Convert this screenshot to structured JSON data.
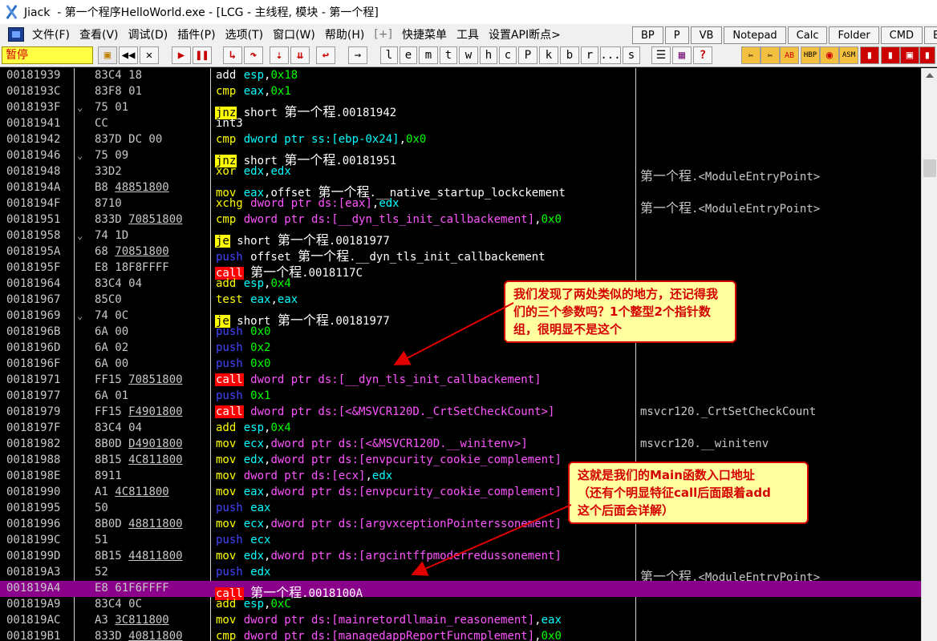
{
  "titlebar": {
    "app_title": "Jiack  - 第一个程序HelloWorld.exe - [LCG - 主线程, 模块 - 第一个程]"
  },
  "menubar": {
    "items": [
      "文件(F)",
      "查看(V)",
      "调试(D)",
      "插件(P)",
      "选项(T)",
      "窗口(W)",
      "帮助(H)",
      "[+]",
      "快捷菜单",
      "工具",
      "设置API断点>"
    ],
    "quick_buttons": [
      "BP",
      "P",
      "VB",
      "Notepad",
      "Calc",
      "Folder",
      "CMD",
      "E"
    ]
  },
  "toolbar": {
    "status": "暂停",
    "letter_buttons": [
      "l",
      "e",
      "m",
      "t",
      "w",
      "h",
      "c",
      "P",
      "k",
      "b",
      "r",
      "...",
      "s"
    ]
  },
  "disasm": {
    "rows": [
      {
        "addr": "00181939",
        "bytes": "83C4 18",
        "jmark": "",
        "mnem": "add",
        "mclass": "plain",
        "ops": [
          [
            "op-reg",
            "esp"
          ],
          [
            "op-text",
            ","
          ],
          [
            "op-imm",
            "0x18"
          ]
        ],
        "comment": ""
      },
      {
        "addr": "0018193C",
        "bytes": "83F8 01",
        "jmark": "",
        "mnem": "cmp",
        "mclass": "cmp",
        "ops": [
          [
            "op-reg",
            "eax"
          ],
          [
            "op-text",
            ","
          ],
          [
            "op-imm",
            "0x1"
          ]
        ],
        "comment": ""
      },
      {
        "addr": "0018193F",
        "bytes": "75 01",
        "jmark": "⌄",
        "mnem": "jnz",
        "mclass": "jmp",
        "ops": [
          [
            "op-text",
            " short "
          ],
          [
            "cjk",
            "第一个程"
          ],
          [
            "op-text",
            ".00181942"
          ]
        ],
        "comment": ""
      },
      {
        "addr": "00181941",
        "bytes": "CC",
        "jmark": "",
        "mnem": "int3",
        "mclass": "plain",
        "ops": [],
        "comment": ""
      },
      {
        "addr": "00181942",
        "bytes": "837D DC 00",
        "jmark": "",
        "mnem": "cmp",
        "mclass": "cmp",
        "ops": [
          [
            "op-reg",
            "dword ptr ss:[ebp-0x24]"
          ],
          [
            "op-text",
            ","
          ],
          [
            "op-imm",
            "0x0"
          ]
        ],
        "comment": ""
      },
      {
        "addr": "00181946",
        "bytes": "75 09",
        "jmark": "⌄",
        "mnem": "jnz",
        "mclass": "jmp",
        "ops": [
          [
            "op-text",
            " short "
          ],
          [
            "cjk",
            "第一个程"
          ],
          [
            "op-text",
            ".00181951"
          ]
        ],
        "comment": ""
      },
      {
        "addr": "00181948",
        "bytes": "33D2",
        "jmark": "",
        "mnem": "xor",
        "mclass": "mov",
        "ops": [
          [
            "op-reg",
            "edx"
          ],
          [
            "op-text",
            ","
          ],
          [
            "op-reg",
            "edx"
          ]
        ],
        "comment": "第一个程.<ModuleEntryPoint>"
      },
      {
        "addr": "0018194A",
        "bytes": "B8 48851800",
        "ul": "48851800",
        "jmark": "",
        "mnem": "mov",
        "mclass": "mov",
        "ops": [
          [
            "op-reg",
            "eax"
          ],
          [
            "op-text",
            ",offset "
          ],
          [
            "cjk",
            "第一个程"
          ],
          [
            "op-text",
            ".__native_startup_lockckement"
          ]
        ],
        "comment": ""
      },
      {
        "addr": "0018194F",
        "bytes": "8710",
        "jmark": "",
        "mnem": "xchg",
        "mclass": "mov",
        "ops": [
          [
            "op-mem",
            "dword ptr ds:[eax]"
          ],
          [
            "op-text",
            ","
          ],
          [
            "op-reg",
            "edx"
          ]
        ],
        "comment": "第一个程.<ModuleEntryPoint>"
      },
      {
        "addr": "00181951",
        "bytes": "833D 70851800",
        "ul": "70851800",
        "jmark": "",
        "mnem": "cmp",
        "mclass": "cmp",
        "ops": [
          [
            "op-mem",
            "dword ptr ds:[__dyn_tls_init_callbackement]"
          ],
          [
            "op-text",
            ","
          ],
          [
            "op-imm",
            "0x0"
          ]
        ],
        "comment": ""
      },
      {
        "addr": "00181958",
        "bytes": "74 1D",
        "jmark": "⌄",
        "mnem": "je",
        "mclass": "jmp",
        "ops": [
          [
            "op-text",
            " short "
          ],
          [
            "cjk",
            "第一个程"
          ],
          [
            "op-text",
            ".00181977"
          ]
        ],
        "comment": ""
      },
      {
        "addr": "0018195A",
        "bytes": "68 70851800",
        "ul": "70851800",
        "jmark": "",
        "mnem": "push",
        "mclass": "push",
        "ops": [
          [
            "op-text",
            " offset "
          ],
          [
            "cjk",
            "第一个程"
          ],
          [
            "op-text",
            ".__dyn_tls_init_callbackement"
          ]
        ],
        "comment": ""
      },
      {
        "addr": "0018195F",
        "bytes": "E8 18F8FFFF",
        "jmark": "",
        "mnem": "call",
        "mclass": "call",
        "ops": [
          [
            "op-text",
            " "
          ],
          [
            "cjk",
            "第一个程"
          ],
          [
            "op-text",
            ".0018117C"
          ]
        ],
        "comment": ""
      },
      {
        "addr": "00181964",
        "bytes": "83C4 04",
        "jmark": "",
        "mnem": "add",
        "mclass": "mov",
        "ops": [
          [
            "op-reg",
            "esp"
          ],
          [
            "op-text",
            ","
          ],
          [
            "op-imm",
            "0x4"
          ]
        ],
        "comment": ""
      },
      {
        "addr": "00181967",
        "bytes": "85C0",
        "jmark": "",
        "mnem": "test",
        "mclass": "mov",
        "ops": [
          [
            "op-reg",
            "eax"
          ],
          [
            "op-text",
            ","
          ],
          [
            "op-reg",
            "eax"
          ]
        ],
        "comment": ""
      },
      {
        "addr": "00181969",
        "bytes": "74 0C",
        "jmark": "⌄",
        "mnem": "je",
        "mclass": "jmp",
        "ops": [
          [
            "op-text",
            " short "
          ],
          [
            "cjk",
            "第一个程"
          ],
          [
            "op-text",
            ".00181977"
          ]
        ],
        "comment": ""
      },
      {
        "addr": "0018196B",
        "bytes": "6A 00",
        "jmark": "",
        "mnem": "push",
        "mclass": "push",
        "ops": [
          [
            "op-imm",
            " 0x0"
          ]
        ],
        "comment": ""
      },
      {
        "addr": "0018196D",
        "bytes": "6A 02",
        "jmark": "",
        "mnem": "push",
        "mclass": "push",
        "ops": [
          [
            "op-imm",
            " 0x2"
          ]
        ],
        "comment": ""
      },
      {
        "addr": "0018196F",
        "bytes": "6A 00",
        "jmark": "",
        "mnem": "push",
        "mclass": "push",
        "ops": [
          [
            "op-imm",
            " 0x0"
          ]
        ],
        "comment": ""
      },
      {
        "addr": "00181971",
        "bytes": "FF15 70851800",
        "ul": "70851800",
        "jmark": "",
        "mnem": "call",
        "mclass": "call",
        "ops": [
          [
            "op-mem",
            " dword ptr ds:[__dyn_tls_init_callbackement]"
          ]
        ],
        "comment": ""
      },
      {
        "addr": "00181977",
        "bytes": "6A 01",
        "jmark": "",
        "mnem": "push",
        "mclass": "push",
        "ops": [
          [
            "op-imm",
            " 0x1"
          ]
        ],
        "comment": ""
      },
      {
        "addr": "00181979",
        "bytes": "FF15 F4901800",
        "ul": "F4901800",
        "jmark": "",
        "mnem": "call",
        "mclass": "call",
        "ops": [
          [
            "op-mem",
            " dword ptr ds:[<&MSVCR120D._CrtSetCheckCount>]"
          ]
        ],
        "comment": "msvcr120._CrtSetCheckCount"
      },
      {
        "addr": "0018197F",
        "bytes": "83C4 04",
        "jmark": "",
        "mnem": "add",
        "mclass": "mov",
        "ops": [
          [
            "op-reg",
            "esp"
          ],
          [
            "op-text",
            ","
          ],
          [
            "op-imm",
            "0x4"
          ]
        ],
        "comment": ""
      },
      {
        "addr": "00181982",
        "bytes": "8B0D D4901800",
        "ul": "D4901800",
        "jmark": "",
        "mnem": "mov",
        "mclass": "mov",
        "ops": [
          [
            "op-reg",
            "ecx"
          ],
          [
            "op-text",
            ","
          ],
          [
            "op-mem",
            "dword ptr ds:[<&MSVCR120D.__winitenv>]"
          ]
        ],
        "comment": "msvcr120.__winitenv"
      },
      {
        "addr": "00181988",
        "bytes": "8B15 4C811800",
        "ul": "4C811800",
        "jmark": "",
        "mnem": "mov",
        "mclass": "mov",
        "ops": [
          [
            "op-reg",
            "edx"
          ],
          [
            "op-text",
            ","
          ],
          [
            "op-mem",
            "dword ptr ds:[envpcurity_cookie_complement]"
          ]
        ],
        "comment": ""
      },
      {
        "addr": "0018198E",
        "bytes": "8911",
        "jmark": "",
        "mnem": "mov",
        "mclass": "mov",
        "ops": [
          [
            "op-mem",
            "dword ptr ds:[ecx]"
          ],
          [
            "op-text",
            ","
          ],
          [
            "op-reg",
            "edx"
          ]
        ],
        "comment": "Point>"
      },
      {
        "addr": "00181990",
        "bytes": "A1 4C811800",
        "ul": "4C811800",
        "jmark": "",
        "mnem": "mov",
        "mclass": "mov",
        "ops": [
          [
            "op-reg",
            "eax"
          ],
          [
            "op-text",
            ","
          ],
          [
            "op-mem",
            "dword ptr ds:[envpcurity_cookie_complement]"
          ]
        ],
        "comment": ""
      },
      {
        "addr": "00181995",
        "bytes": "50",
        "jmark": "",
        "mnem": "push",
        "mclass": "push",
        "ops": [
          [
            "op-reg",
            " eax"
          ]
        ],
        "comment": ""
      },
      {
        "addr": "00181996",
        "bytes": "8B0D 48811800",
        "ul": "48811800",
        "jmark": "",
        "mnem": "mov",
        "mclass": "mov",
        "ops": [
          [
            "op-reg",
            "ecx"
          ],
          [
            "op-text",
            ","
          ],
          [
            "op-mem",
            "dword ptr ds:[argvxceptionPointerssonement]"
          ]
        ],
        "comment": ""
      },
      {
        "addr": "0018199C",
        "bytes": "51",
        "jmark": "",
        "mnem": "push",
        "mclass": "push",
        "ops": [
          [
            "op-reg",
            " ecx"
          ]
        ],
        "comment": ""
      },
      {
        "addr": "0018199D",
        "bytes": "8B15 44811800",
        "ul": "44811800",
        "jmark": "",
        "mnem": "mov",
        "mclass": "mov",
        "ops": [
          [
            "op-reg",
            "edx"
          ],
          [
            "op-text",
            ","
          ],
          [
            "op-mem",
            "dword ptr ds:[argcintffpmoderredussonement]"
          ]
        ],
        "comment": ""
      },
      {
        "addr": "001819A3",
        "bytes": "52",
        "jmark": "",
        "mnem": "push",
        "mclass": "push",
        "ops": [
          [
            "op-reg",
            " edx"
          ]
        ],
        "comment": "第一个程.<ModuleEntryPoint>"
      },
      {
        "addr": "001819A4",
        "bytes": "E8 61F6FFFF",
        "jmark": "",
        "mnem": "call",
        "mclass": "call",
        "ops": [
          [
            "op-text",
            " "
          ],
          [
            "cjk",
            "第一个程"
          ],
          [
            "op-text",
            ".0018100A"
          ]
        ],
        "comment": "",
        "selected": true
      },
      {
        "addr": "001819A9",
        "bytes": "83C4 0C",
        "jmark": "",
        "mnem": "add",
        "mclass": "mov",
        "ops": [
          [
            "op-reg",
            "esp"
          ],
          [
            "op-text",
            ","
          ],
          [
            "op-imm",
            "0xC"
          ]
        ],
        "comment": ""
      },
      {
        "addr": "001819AC",
        "bytes": "A3 3C811800",
        "ul": "3C811800",
        "jmark": "",
        "mnem": "mov",
        "mclass": "mov",
        "ops": [
          [
            "op-mem",
            "dword ptr ds:[mainretordllmain_reasonement]"
          ],
          [
            "op-text",
            ","
          ],
          [
            "op-reg",
            "eax"
          ]
        ],
        "comment": ""
      },
      {
        "addr": "001819B1",
        "bytes": "833D 40811800",
        "ul": "40811800",
        "jmark": "",
        "mnem": "cmp",
        "mclass": "cmp",
        "ops": [
          [
            "op-mem",
            "dword ptr ds:[managedappReportFuncmplement]"
          ],
          [
            "op-text",
            ","
          ],
          [
            "op-imm",
            "0x0"
          ]
        ],
        "comment": ""
      }
    ]
  },
  "annotations": {
    "note1": "我们发现了两处类似的地方，还记得我们的三个参数吗？1个整型2个指针数组，很明显不是这个",
    "note2_line1": "这就是我们的Main函数入口地址",
    "note2_line2": "（还有个明显特征call后面跟着add",
    "note2_line3": "这个后面会详解）"
  },
  "colors": {
    "background": "#000000",
    "selected_row": "#8b008b",
    "call_bg": "#ff0000",
    "jump_bg": "#ffff00",
    "note_border": "#d40000",
    "note_bg": "#ffffa0"
  }
}
